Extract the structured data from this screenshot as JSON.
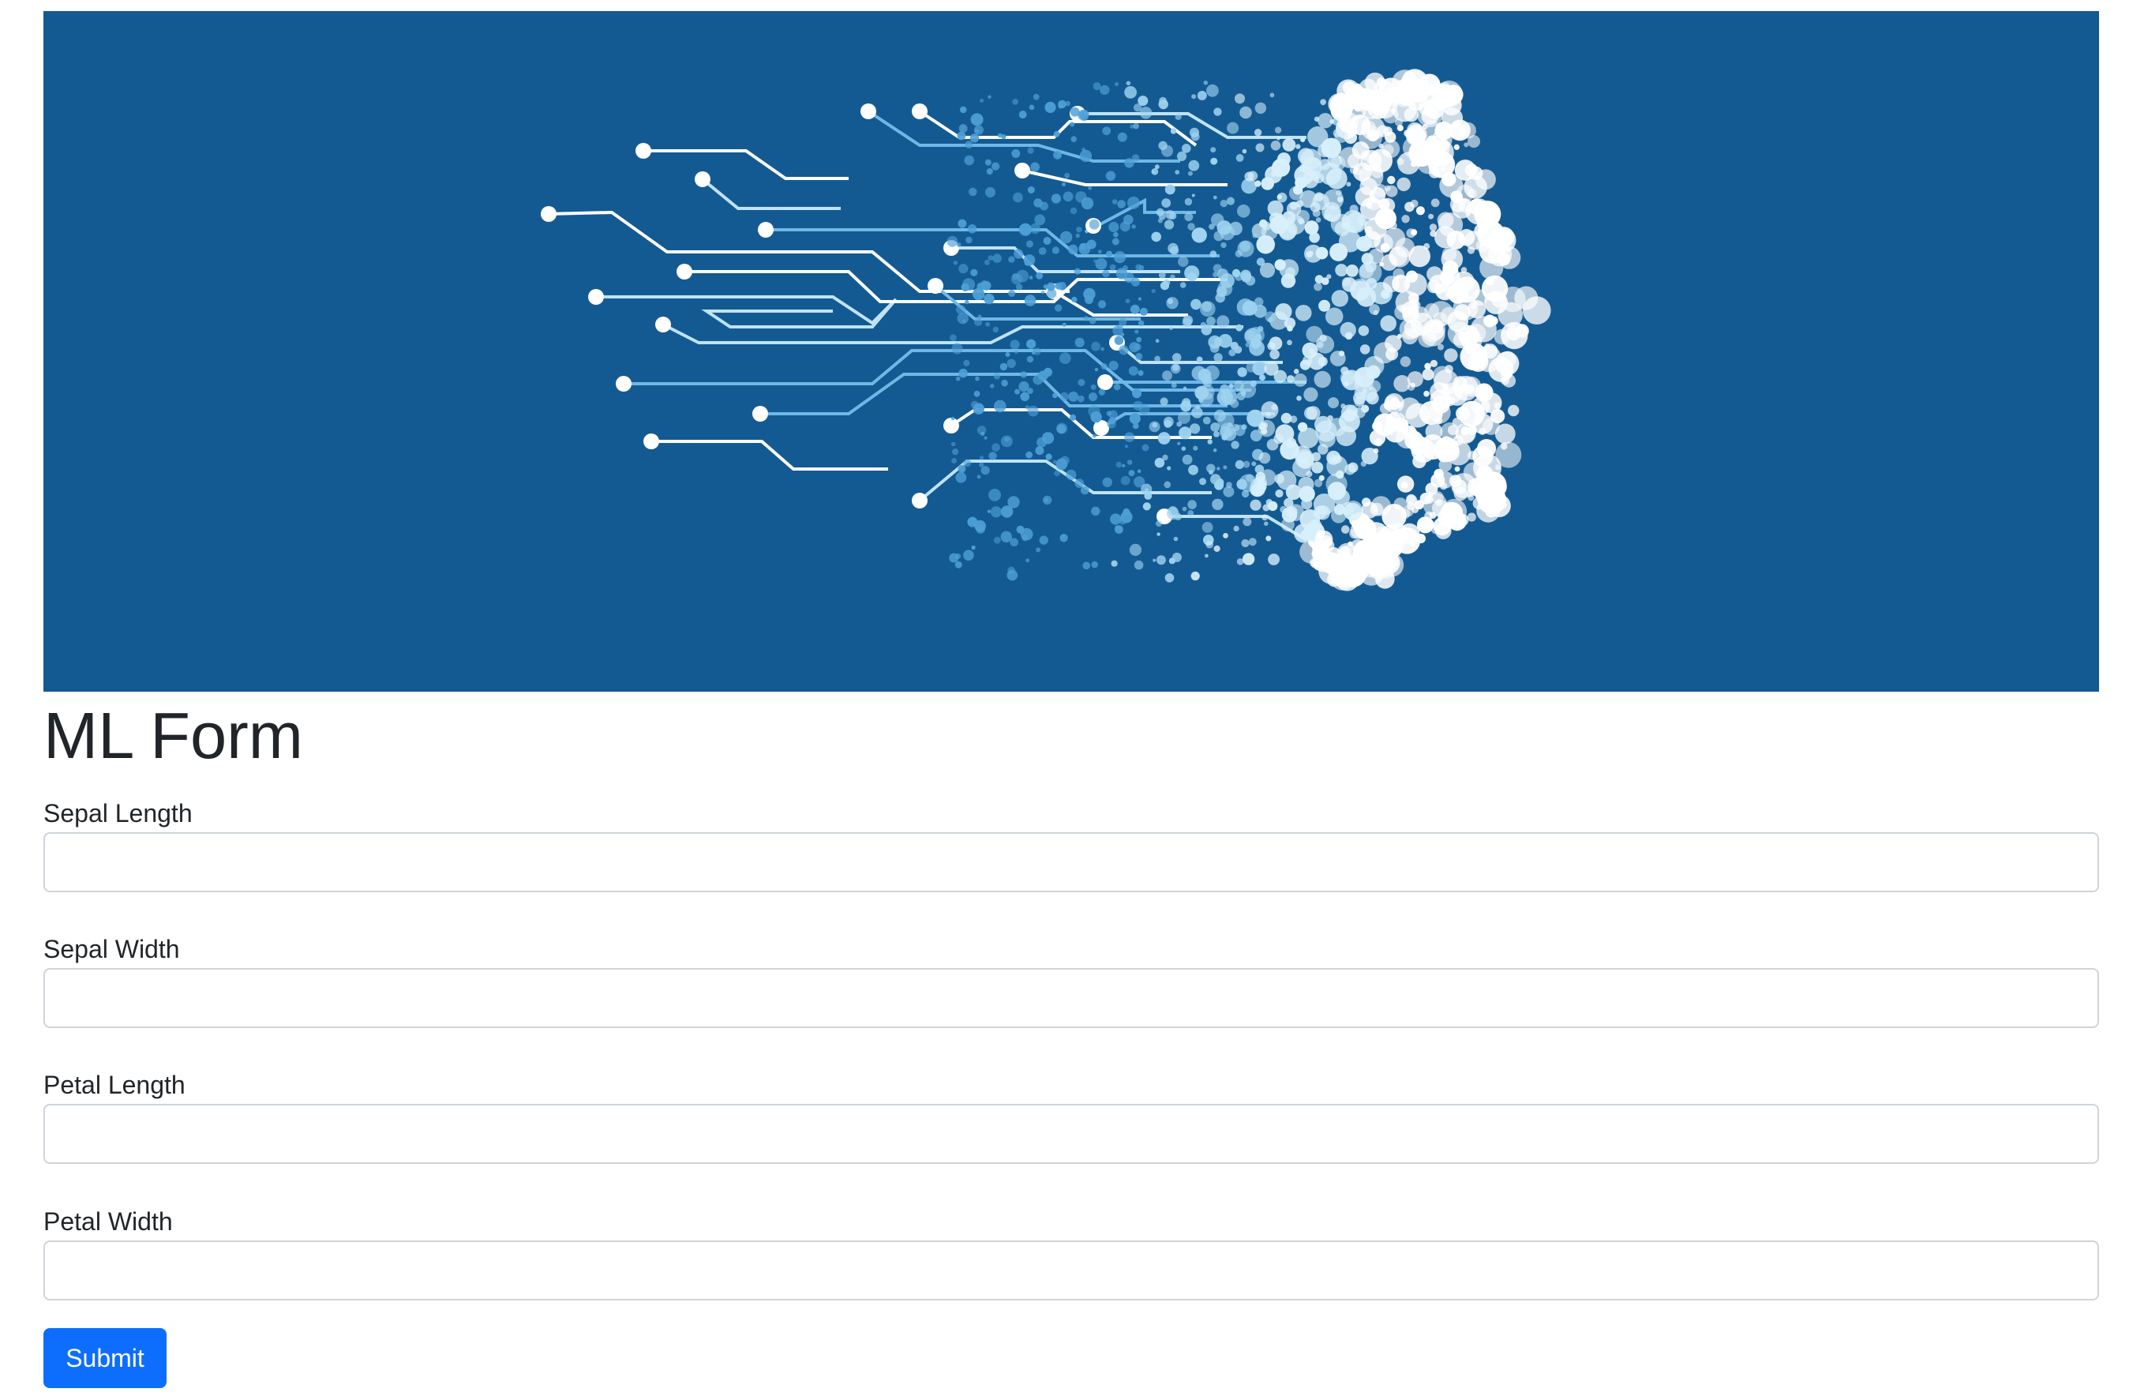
{
  "form": {
    "title": "ML Form",
    "fields": [
      {
        "label": "Sepal Length",
        "value": "",
        "placeholder": ""
      },
      {
        "label": "Sepal Width",
        "value": "",
        "placeholder": ""
      },
      {
        "label": "Petal Length",
        "value": "",
        "placeholder": ""
      },
      {
        "label": "Petal Width",
        "value": "",
        "placeholder": ""
      }
    ],
    "submit_label": "Submit"
  },
  "banner": {
    "image": "circuit-ai-head-illustration",
    "background": "#145a92"
  },
  "colors": {
    "primary": "#0d6efd",
    "border": "#ced4da"
  }
}
